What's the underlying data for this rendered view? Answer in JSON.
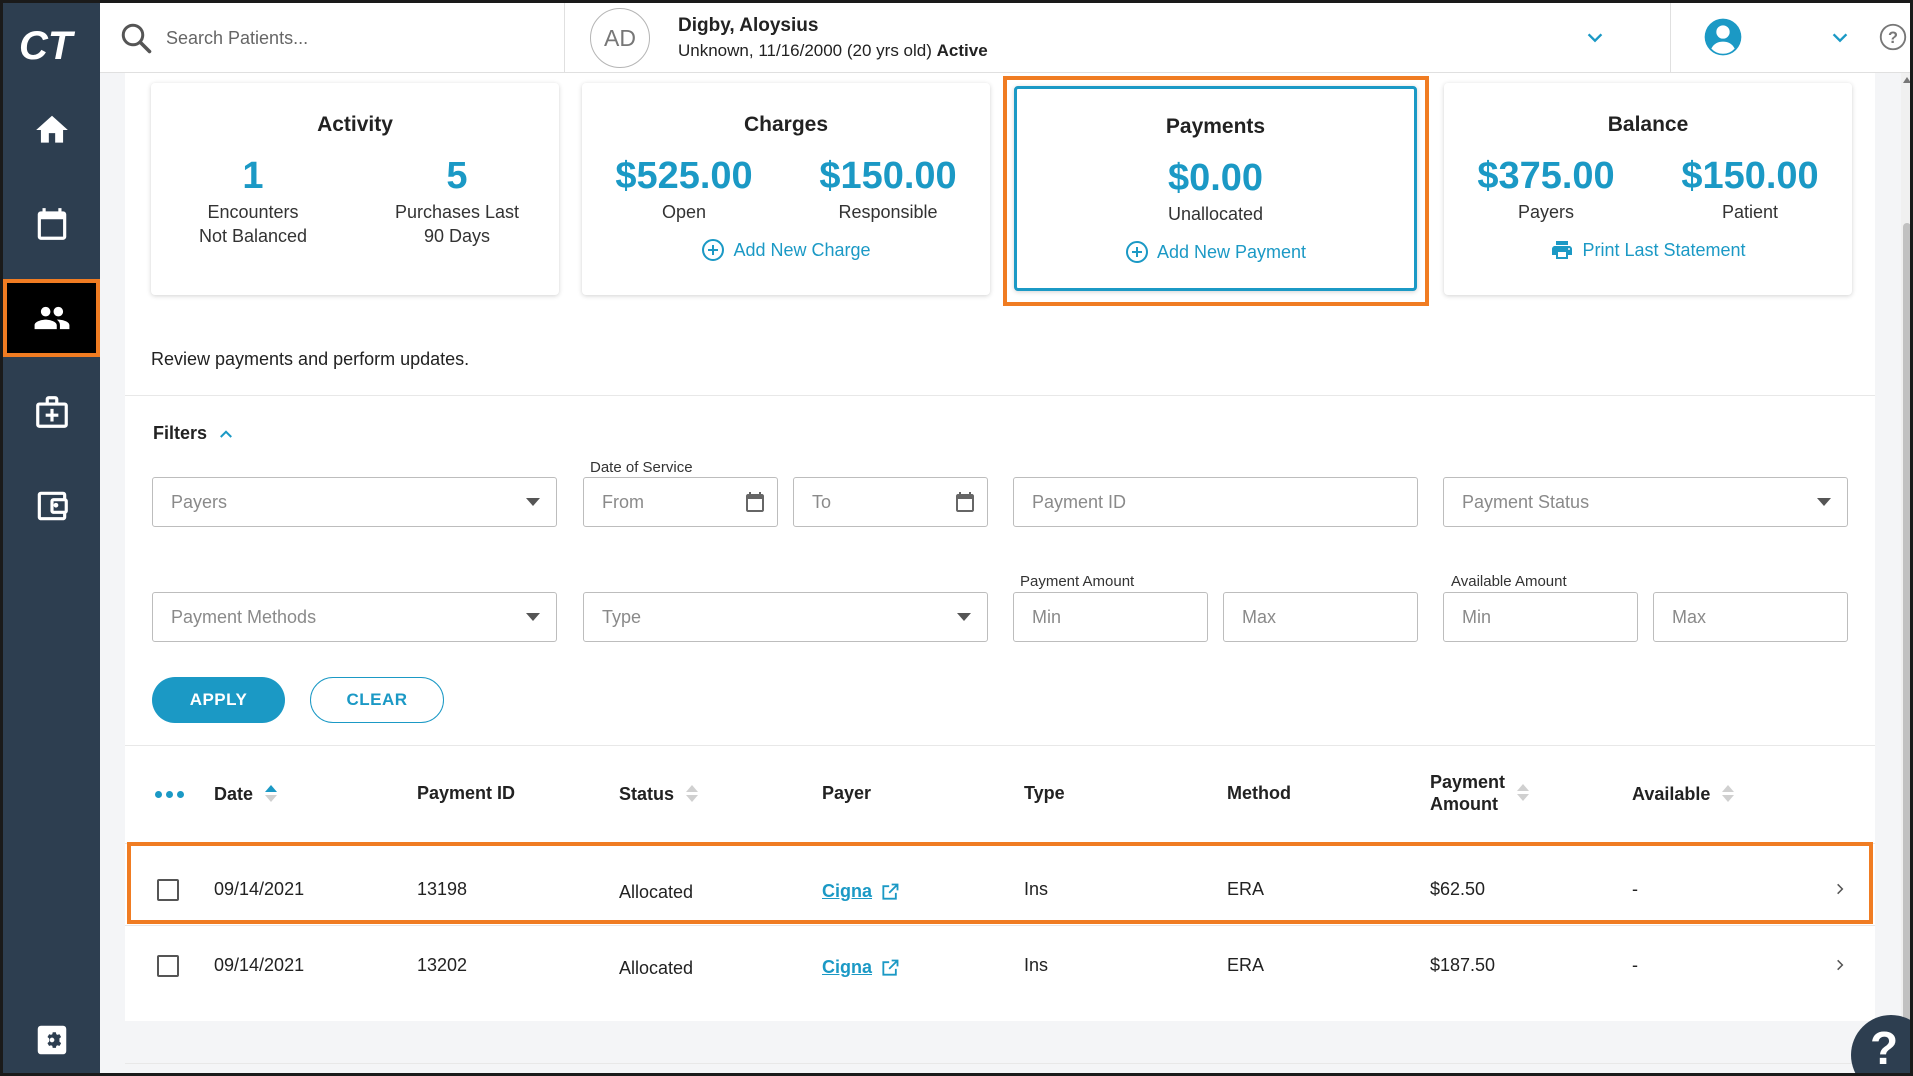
{
  "app": {
    "logo_text": "CT"
  },
  "search": {
    "placeholder": "Search Patients..."
  },
  "patient": {
    "initials": "AD",
    "name": "Digby, Aloysius",
    "details": "Unknown, 11/16/2000 (20 yrs old)",
    "status": "Active"
  },
  "nav": {
    "items": [
      {
        "name": "home",
        "icon": "home-icon"
      },
      {
        "name": "calendar",
        "icon": "calendar-icon"
      },
      {
        "name": "patients",
        "icon": "people-icon",
        "active": true
      },
      {
        "name": "medical",
        "icon": "medical-kit-icon"
      },
      {
        "name": "wallet",
        "icon": "wallet-icon"
      },
      {
        "name": "settings",
        "icon": "gear-icon"
      }
    ]
  },
  "cards": {
    "activity": {
      "title": "Activity",
      "v1": "1",
      "l1": "Encounters\nNot Balanced",
      "v2": "5",
      "l2": "Purchases Last\n90 Days"
    },
    "charges": {
      "title": "Charges",
      "v1": "$525.00",
      "l1": "Open",
      "v2": "$150.00",
      "l2": "Responsible",
      "link": "Add New Charge"
    },
    "payments": {
      "title": "Payments",
      "v1": "$0.00",
      "l1": "Unallocated",
      "link": "Add New Payment"
    },
    "balance": {
      "title": "Balance",
      "v1": "$375.00",
      "l1": "Payers",
      "v2": "$150.00",
      "l2": "Patient",
      "link": "Print Last Statement"
    }
  },
  "review_text": "Review payments and perform updates.",
  "filters": {
    "title": "Filters",
    "payers_placeholder": "Payers",
    "date_of_service_label": "Date of Service",
    "from_placeholder": "From",
    "to_placeholder": "To",
    "payment_id_placeholder": "Payment ID",
    "payment_status_placeholder": "Payment Status",
    "payment_methods_placeholder": "Payment Methods",
    "type_placeholder": "Type",
    "payment_amount_label": "Payment Amount",
    "available_amount_label": "Available Amount",
    "min_placeholder": "Min",
    "max_placeholder": "Max",
    "apply_label": "APPLY",
    "clear_label": "CLEAR"
  },
  "table": {
    "headers": {
      "date": "Date",
      "payment_id": "Payment ID",
      "status": "Status",
      "payer": "Payer",
      "type": "Type",
      "method": "Method",
      "payment_amount_line1": "Payment",
      "payment_amount_line2": "Amount",
      "available": "Available"
    },
    "rows": [
      {
        "date": "09/14/2021",
        "payment_id": "13198",
        "status": "Allocated",
        "payer": "Cigna",
        "type": "Ins",
        "method": "ERA",
        "amount": "$62.50",
        "available": "-"
      },
      {
        "date": "09/14/2021",
        "payment_id": "13202",
        "status": "Allocated",
        "payer": "Cigna",
        "type": "Ins",
        "method": "ERA",
        "amount": "$187.50",
        "available": "-"
      }
    ]
  },
  "help_fab_label": "?",
  "colors": {
    "accent": "#1b99c5",
    "rail": "#2d3e50",
    "highlight": "#f07c22"
  }
}
